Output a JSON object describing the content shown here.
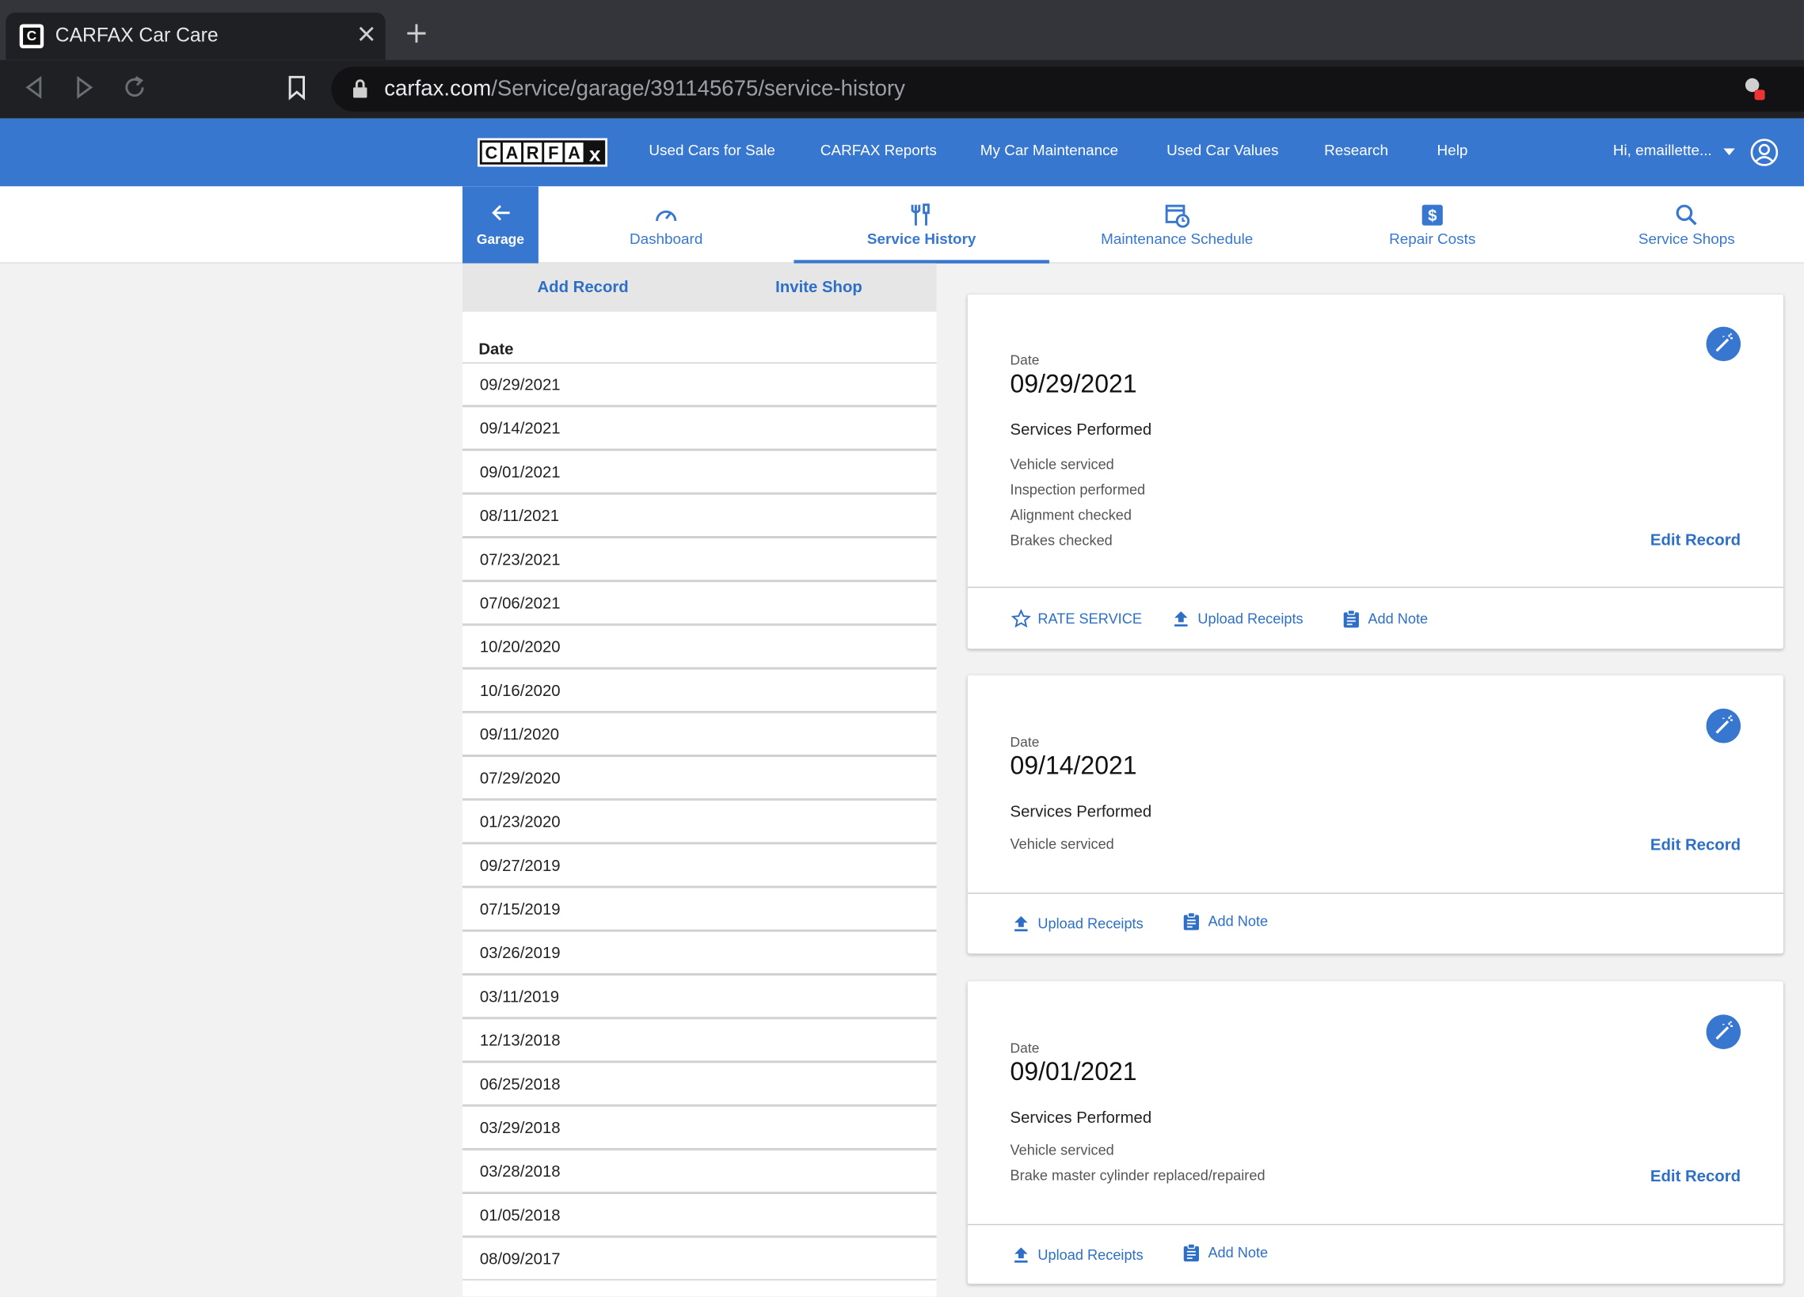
{
  "browser": {
    "tab_title": "CARFAX Car Care",
    "favicon_letter": "C",
    "url_domain": "carfax.com",
    "url_path": "/Service/garage/391145675/service-history"
  },
  "site_nav": {
    "logo_text": "CARFAX",
    "links": [
      "Used Cars for Sale",
      "CARFAX Reports",
      "My Car Maintenance",
      "Used Car Values",
      "Research",
      "Help"
    ],
    "user_greeting": "Hi, emaillette..."
  },
  "sub_nav": {
    "back_label": "Garage",
    "tabs": [
      "Dashboard",
      "Service History",
      "Maintenance Schedule",
      "Repair Costs",
      "Service Shops"
    ],
    "active_tab": "Service History"
  },
  "left_panel": {
    "add_record": "Add Record",
    "invite_shop": "Invite Shop",
    "date_header": "Date",
    "dates": [
      "09/29/2021",
      "09/14/2021",
      "09/01/2021",
      "08/11/2021",
      "07/23/2021",
      "07/06/2021",
      "10/20/2020",
      "10/16/2020",
      "09/11/2020",
      "07/29/2020",
      "01/23/2020",
      "09/27/2019",
      "07/15/2019",
      "03/26/2019",
      "03/11/2019",
      "12/13/2018",
      "06/25/2018",
      "03/29/2018",
      "03/28/2018",
      "01/05/2018",
      "08/09/2017"
    ]
  },
  "cards": [
    {
      "date_label": "Date",
      "date": "09/29/2021",
      "services_title": "Services Performed",
      "services": [
        "Vehicle serviced",
        "Inspection performed",
        "Alignment checked",
        "Brakes checked"
      ],
      "edit": "Edit Record",
      "rate": "RATE SERVICE",
      "upload": "Upload Receipts",
      "note": "Add Note"
    },
    {
      "date_label": "Date",
      "date": "09/14/2021",
      "services_title": "Services Performed",
      "services": [
        "Vehicle serviced"
      ],
      "edit": "Edit Record",
      "upload": "Upload Receipts",
      "note": "Add Note"
    },
    {
      "date_label": "Date",
      "date": "09/01/2021",
      "services_title": "Services Performed",
      "services": [
        "Vehicle serviced",
        "Brake master cylinder replaced/repaired"
      ],
      "edit": "Edit Record",
      "upload": "Upload Receipts",
      "note": "Add Note"
    }
  ],
  "colors": {
    "brand_blue": "#3777d0",
    "link_blue": "#2d6fc7"
  }
}
